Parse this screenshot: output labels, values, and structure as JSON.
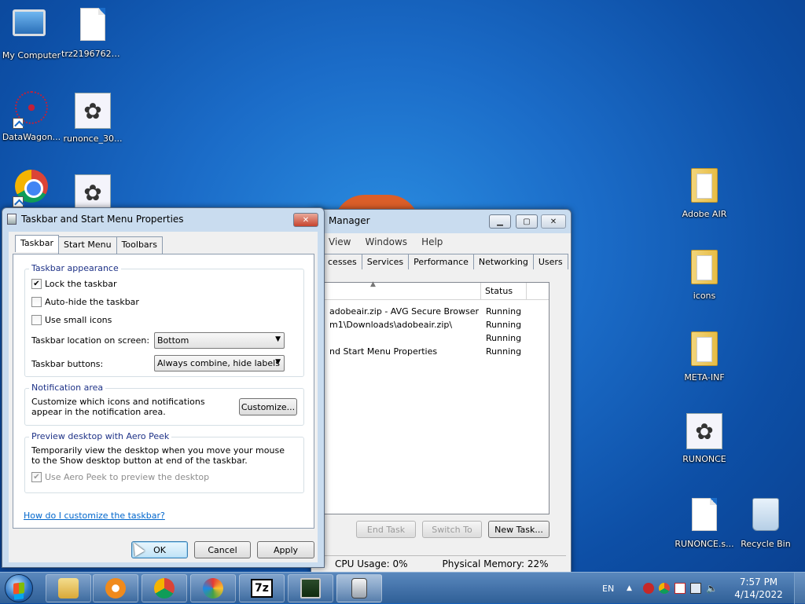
{
  "desktop": {
    "icons": [
      {
        "label": "My Computer"
      },
      {
        "label": "trz21967624..."
      },
      {
        "label": "DataWagon..."
      },
      {
        "label": "runonce_30..."
      },
      {
        "label": "Adobe AIR"
      },
      {
        "label": "icons"
      },
      {
        "label": "META-INF"
      },
      {
        "label": "RUNONCE"
      },
      {
        "label": "RUNONCE.s..."
      },
      {
        "label": "Recycle Bin"
      }
    ]
  },
  "task_manager": {
    "title": "Manager",
    "menu": [
      "View",
      "Windows",
      "Help"
    ],
    "tabs": [
      "cesses",
      "Services",
      "Performance",
      "Networking",
      "Users"
    ],
    "column_status": "Status",
    "rows": [
      {
        "task": "adobeair.zip - AVG Secure Browser",
        "status": "Running"
      },
      {
        "task": "m1\\Downloads\\adobeair.zip\\",
        "status": "Running"
      },
      {
        "task": "",
        "status": "Running"
      },
      {
        "task": "nd Start Menu Properties",
        "status": "Running"
      }
    ],
    "buttons": {
      "end_task": "End Task",
      "switch_to": "Switch To",
      "new_task": "New Task..."
    },
    "status_cpu": "CPU Usage: 0%",
    "status_mem": "Physical Memory: 22%"
  },
  "props": {
    "title": "Taskbar and Start Menu Properties",
    "tabs": [
      "Taskbar",
      "Start Menu",
      "Toolbars"
    ],
    "appearance": {
      "title": "Taskbar appearance",
      "lock": "Lock the taskbar",
      "autohide": "Auto-hide the taskbar",
      "small_icons": "Use small icons",
      "location_label": "Taskbar location on screen:",
      "location_value": "Bottom",
      "buttons_label": "Taskbar buttons:",
      "buttons_value": "Always combine, hide labels"
    },
    "notification": {
      "title": "Notification area",
      "text": "Customize which icons and notifications appear in the notification area.",
      "customize": "Customize..."
    },
    "peek": {
      "title": "Preview desktop with Aero Peek",
      "text": "Temporarily view the desktop when you move your mouse to the Show desktop button at end of the taskbar.",
      "check": "Use Aero Peek to preview the desktop"
    },
    "help_link": "How do I customize the taskbar?",
    "ok": "OK",
    "cancel": "Cancel",
    "apply": "Apply"
  },
  "taskbar": {
    "lang": "EN",
    "time": "7:57 PM",
    "date": "4/14/2022",
    "seven_zip": "7z"
  }
}
